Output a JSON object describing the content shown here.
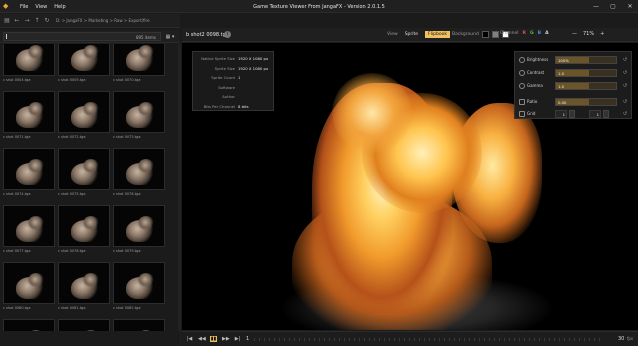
{
  "titlebar": {
    "logo_icon": "layers-icon",
    "menu": [
      "File",
      "View",
      "Help"
    ],
    "title": "Game Texture Viewer From JangaFX - Version 2.0.1.5",
    "controls": [
      "—",
      "▢",
      "✕"
    ]
  },
  "nav": {
    "buttons": [
      "▤",
      "←",
      "→",
      "↑",
      "↻"
    ],
    "breadcrumb": "D: > JangaFX > Marketing > Raw > Export/fire"
  },
  "search": {
    "value": "",
    "placeholder": "",
    "count": "895 items",
    "view_toggle": "▦ ▾"
  },
  "thumbnails": [
    {
      "name": "c shot 0004.tga"
    },
    {
      "name": "c shot 0005.tga"
    },
    {
      "name": "c shot 0070.tga"
    },
    {
      "name": "c shot 0071.tga"
    },
    {
      "name": "c shot 0072.tga"
    },
    {
      "name": "c shot 0073.tga"
    },
    {
      "name": "c shot 0074.tga"
    },
    {
      "name": "c shot 0075.tga"
    },
    {
      "name": "c shot 0076.tga"
    },
    {
      "name": "c shot 0077.tga"
    },
    {
      "name": "c shot 0078.tga"
    },
    {
      "name": "c shot 0079.tga"
    },
    {
      "name": "c shot 0080.tga"
    },
    {
      "name": "c shot 0081.tga"
    },
    {
      "name": "c shot 0082.tga"
    },
    {
      "name": "",
      "partial": true
    },
    {
      "name": "",
      "partial": true
    },
    {
      "name": "",
      "partial": true
    }
  ],
  "viewer": {
    "file_name": "b shot2 0098.tga",
    "view_label": "View",
    "view_options": [
      {
        "label": "Sprite",
        "active": false
      },
      {
        "label": "Flipbook",
        "active": true
      }
    ],
    "background_label": "Background",
    "background_swatches": [
      "#000000",
      "#808080",
      "#ffffff"
    ],
    "channel_label": "Channel",
    "channels": [
      {
        "label": "R",
        "color": "#e05050"
      },
      {
        "label": "G",
        "color": "#50c050"
      },
      {
        "label": "B",
        "color": "#5080e0"
      },
      {
        "label": "A",
        "color": "#d0d0d0"
      }
    ],
    "zoom_minus": "—",
    "zoom": "71%",
    "zoom_plus": "+"
  },
  "properties": [
    {
      "key": "Native Sprite Size",
      "value": "1920 X 1080 px"
    },
    {
      "key": "Sprite Size",
      "value": "1920 X 1080 px"
    },
    {
      "key": "Sprite Count",
      "value": "1"
    },
    {
      "key": "Software",
      "value": ""
    },
    {
      "key": "Author",
      "value": ""
    },
    {
      "key": "Bits Per Channel",
      "value": "8 bits"
    }
  ],
  "adjustments": [
    {
      "label": "Brightness",
      "value": "100%",
      "fill": 0.55
    },
    {
      "label": "Contrast",
      "value": "1.0",
      "fill": 0.55
    },
    {
      "label": "Gamma",
      "value": "1.0",
      "fill": 0.55
    },
    {
      "label": "Ratio",
      "value": "0.00",
      "fill": 0.55
    }
  ],
  "grid": {
    "label": "Grid",
    "x": "1",
    "y": "1"
  },
  "playback": {
    "buttons": [
      "|◀",
      "◀◀",
      "▮▮",
      "▶▶",
      "▶|"
    ],
    "frame": "1",
    "fps": "30",
    "fps_unit": "fps"
  }
}
